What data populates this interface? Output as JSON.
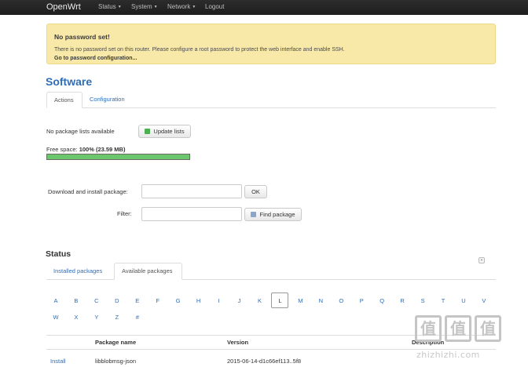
{
  "navbar": {
    "brand": "OpenWrt",
    "items": [
      {
        "label": "Status",
        "has_dropdown": true
      },
      {
        "label": "System",
        "has_dropdown": true
      },
      {
        "label": "Network",
        "has_dropdown": true
      },
      {
        "label": "Logout",
        "has_dropdown": false
      }
    ]
  },
  "alert": {
    "title": "No password set!",
    "text": "There is no password set on this router. Please configure a root password to protect the web interface and enable SSH.",
    "link": "Go to password configuration..."
  },
  "page_title": "Software",
  "top_tabs": [
    {
      "label": "Actions",
      "active": true
    },
    {
      "label": "Configuration",
      "active": false
    }
  ],
  "actions": {
    "no_lists_text": "No package lists available",
    "update_button": "Update lists",
    "free_space_label": "Free space: ",
    "free_space_value": "100% (23.59 MB)",
    "free_space_fraction": 1.0,
    "download_label": "Download and install package:",
    "download_value": "",
    "ok_button": "OK",
    "filter_label": "Filter:",
    "filter_value": "",
    "find_button": "Find package"
  },
  "status": {
    "title": "Status",
    "tabs": [
      {
        "label": "Installed packages",
        "active": false
      },
      {
        "label": "Available packages",
        "active": true
      }
    ],
    "letters_row1": [
      "A",
      "B",
      "C",
      "D",
      "E",
      "F",
      "G",
      "H",
      "I",
      "J",
      "K",
      "L",
      "M",
      "N",
      "O",
      "P",
      "Q",
      "R",
      "S",
      "T",
      "U",
      "V"
    ],
    "letters_row2": [
      "W",
      "X",
      "Y",
      "Z",
      "#"
    ],
    "active_letter": "L",
    "table": {
      "headers": [
        "Package name",
        "Version",
        "Description"
      ],
      "rows": [
        {
          "action": "Install",
          "name": "libblobmsg-json",
          "version": "2015-06-14-d1c66ef113..5f8",
          "description": ""
        }
      ]
    }
  },
  "watermark": {
    "glyph": "值",
    "text": "zhizhizhi.com"
  },
  "colors": {
    "accent": "#2f6db5",
    "alert_bg": "#f8e9a8",
    "progress": "#6cc66c",
    "navbar": "#222222"
  }
}
